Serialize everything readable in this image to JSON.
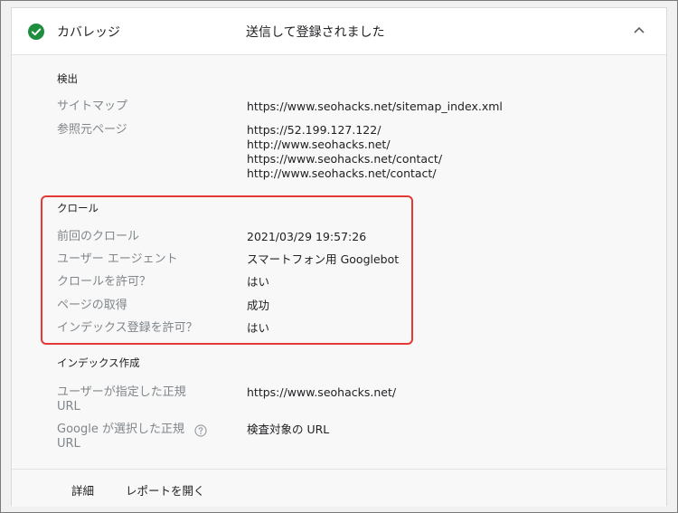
{
  "header": {
    "title": "カバレッジ",
    "status": "送信して登録されました",
    "status_color": "#1e8e3e",
    "icon": "check-circle-icon",
    "toggle_icon": "chevron-up-icon"
  },
  "discovery": {
    "title": "検出",
    "sitemap_label": "サイトマップ",
    "sitemap_value": "https://www.seohacks.net/sitemap_index.xml",
    "referring_label": "参照元ページ",
    "referring_pages": [
      "https://52.199.127.122/",
      "http://www.seohacks.net/",
      "https://www.seohacks.net/contact/",
      "http://www.seohacks.net/contact/"
    ]
  },
  "crawl": {
    "title": "クロール",
    "rows": [
      {
        "label": "前回のクロール",
        "value": "2021/03/29 19:57:26"
      },
      {
        "label": "ユーザー エージェント",
        "value": "スマートフォン用 Googlebot"
      },
      {
        "label": "クロールを許可？",
        "value": "はい"
      },
      {
        "label": "ページの取得",
        "value": "成功"
      },
      {
        "label": "インデックス登録を許可？",
        "value": "はい"
      }
    ],
    "highlight_color": "#e53935"
  },
  "indexing": {
    "title": "インデックス作成",
    "user_canonical_label": "ユーザーが指定した正規 URL",
    "user_canonical_value": "https://www.seohacks.net/",
    "google_canonical_label": "Google が選択した正規 URL",
    "google_canonical_value": "検査対象の URL",
    "help_icon": "help-circle-icon"
  },
  "footer": {
    "details_label": "詳細",
    "open_report_label": "レポートを開く"
  }
}
